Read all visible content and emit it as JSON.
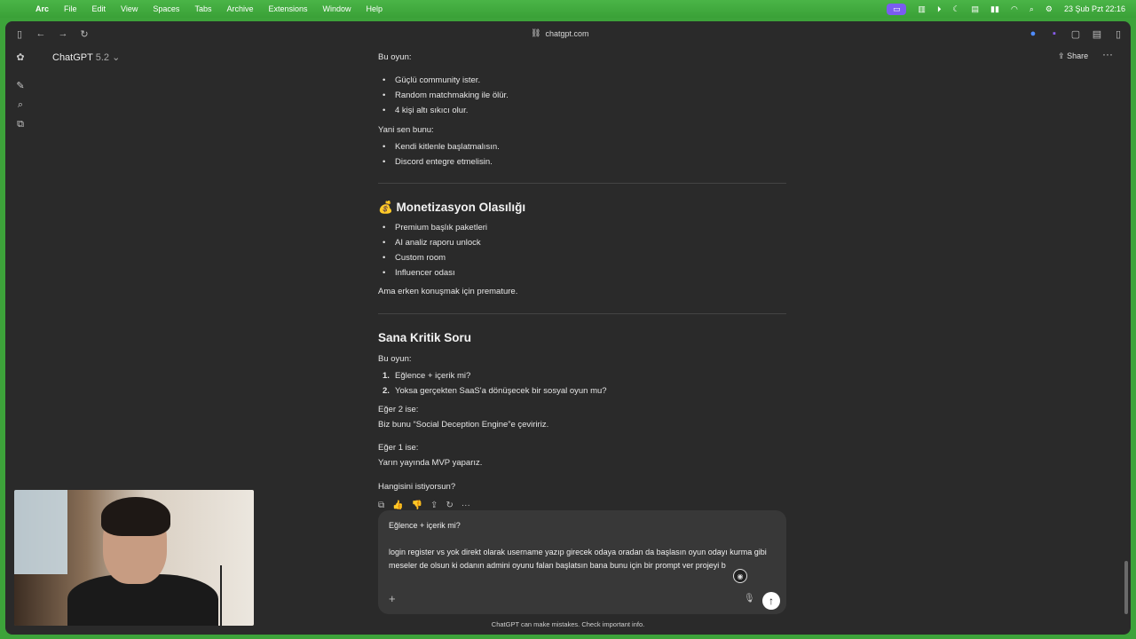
{
  "menubar": {
    "app": "Arc",
    "items": [
      "File",
      "Edit",
      "View",
      "Spaces",
      "Tabs",
      "Archive",
      "Extensions",
      "Window",
      "Help"
    ],
    "datetime": "23 Şub Pzt  22:16"
  },
  "toolbar": {
    "url": "chatgpt.com"
  },
  "header": {
    "model_name": "ChatGPT",
    "model_version": "5.2",
    "share_label": "Share"
  },
  "chat": {
    "intro1": "Bu oyun:",
    "list1": [
      "Güçlü community ister.",
      "Random matchmaking ile ölür.",
      "4 kişi altı sıkıcı olur."
    ],
    "intro2": "Yani sen bunu:",
    "list2": [
      "Kendi kitlenle başlatmalısın.",
      "Discord entegre etmelisin."
    ],
    "heading_monetization": "💰 Monetizasyon Olasılığı",
    "list3": [
      "Premium başlık paketleri",
      "AI analiz raporu unlock",
      "Custom room",
      "Influencer odası"
    ],
    "note": "Ama erken konuşmak için premature.",
    "heading_question": "Sana Kritik Soru",
    "intro3": "Bu oyun:",
    "olist": [
      {
        "n": "1.",
        "text": "Eğlence + içerik mi?"
      },
      {
        "n": "2.",
        "text": "Yoksa gerçekten SaaS'a dönüşecek bir sosyal oyun mu?"
      }
    ],
    "if2": "Eğer 2 ise:",
    "if2_text": "Biz bunu “Social Deception Engine”e çeviririz.",
    "if1": "Eğer 1 ise:",
    "if1_text": "Yarın yayında MVP yaparız.",
    "closing": "Hangisini istiyorsun?"
  },
  "composer": {
    "text": "Eğlence + içerik mi?\n\nlogin register vs yok direkt olarak username yazıp girecek odaya oradan da başlasın oyun odayı kurma gibi meseler de olsun ki odanın admini oyunu falan başlatsın bana bunu için bir prompt ver projeyi b"
  },
  "disclaimer": "ChatGPT can make mistakes. Check important info."
}
